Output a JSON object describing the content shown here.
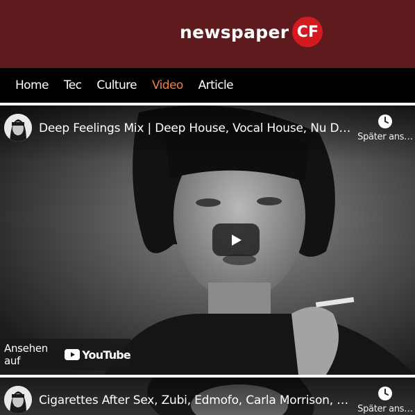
{
  "site": {
    "logo_text": "newspaper",
    "logo_badge": "CF"
  },
  "nav": {
    "items": [
      {
        "label": "Home",
        "active": false
      },
      {
        "label": "Tec",
        "active": false
      },
      {
        "label": "Culture",
        "active": false
      },
      {
        "label": "Video",
        "active": true
      },
      {
        "label": "Article",
        "active": false
      }
    ]
  },
  "videos": [
    {
      "title": "Deep Feelings Mix | Deep House, Vocal House, Nu Disc…",
      "watch_later": "Später ans…",
      "watch_on": "Ansehen auf",
      "youtube": "YouTube"
    },
    {
      "title": "Cigarettes After Sex, Zubi, Edmofo, Carla Morrison, Em…",
      "watch_later": "Später ans…"
    }
  ],
  "colors": {
    "header_bg": "#5e1a1c",
    "badge_red": "#d21a1f",
    "nav_active": "#f0803c"
  },
  "icons": [
    "clock-icon",
    "play-icon",
    "youtube-icon",
    "avatar"
  ]
}
